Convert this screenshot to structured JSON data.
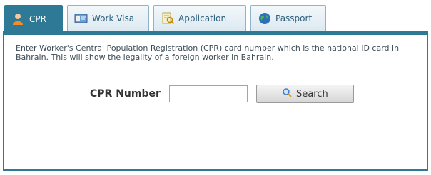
{
  "tabs": [
    {
      "label": "CPR",
      "icon": "user-icon",
      "active": true
    },
    {
      "label": "Work Visa",
      "icon": "id-card-icon",
      "active": false
    },
    {
      "label": "Application",
      "icon": "document-search-icon",
      "active": false
    },
    {
      "label": "Passport",
      "icon": "globe-icon",
      "active": false
    }
  ],
  "panel": {
    "description": "Enter Worker's Central Population Registration (CPR) card number which is the national ID card in Bahrain. This will show the legality of a foreign worker in Bahrain.",
    "cpr_label": "CPR Number",
    "cpr_value": "",
    "search_label": "Search"
  },
  "colors": {
    "accent": "#2e7a96",
    "tab_bg": "#dce9f1",
    "tab_text": "#2c5f7c"
  }
}
